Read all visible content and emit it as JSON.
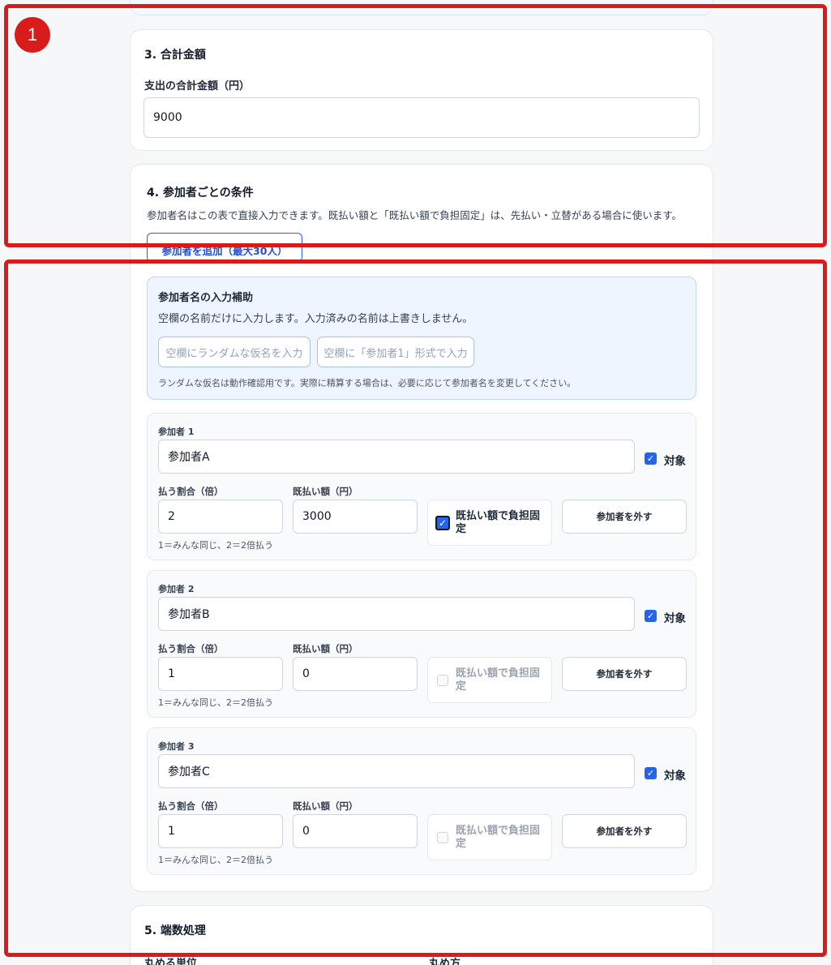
{
  "section3": {
    "title": "3. 合計金額",
    "field_label": "支出の合計金額（円）",
    "value": "9000"
  },
  "section4": {
    "title": "4. 参加者ごとの条件",
    "description": "参加者名はこの表で直接入力できます。既払い額と「既払い額で負担固定」は、先払い・立替がある場合に使います。",
    "add_button": "参加者を追加（最大30人）",
    "helper": {
      "title": "参加者名の入力補助",
      "description": "空欄の名前だけに入力します。入力済みの名前は上書きしません。",
      "random_button": "空欄にランダムな仮名を入力",
      "format_button": "空欄に「参加者1」形式で入力",
      "note": "ランダムな仮名は動作確認用です。実際に精算する場合は、必要に応じて参加者名を変更してください。"
    },
    "participants": [
      {
        "label": "参加者 1",
        "name": "参加者A",
        "target_label": "対象",
        "target_checked": true,
        "ratio_label": "払う割合（倍）",
        "ratio": "2",
        "paid_label": "既払い額（円）",
        "paid": "3000",
        "fixed_label": "既払い額で負担固定",
        "fixed_checked": true,
        "remove_button": "参加者を外す",
        "ratio_hint": "1＝みんな同じ、2＝2倍払う"
      },
      {
        "label": "参加者 2",
        "name": "参加者B",
        "target_label": "対象",
        "target_checked": true,
        "ratio_label": "払う割合（倍）",
        "ratio": "1",
        "paid_label": "既払い額（円）",
        "paid": "0",
        "fixed_label": "既払い額で負担固定",
        "fixed_checked": false,
        "remove_button": "参加者を外す",
        "ratio_hint": "1＝みんな同じ、2＝2倍払う"
      },
      {
        "label": "参加者 3",
        "name": "参加者C",
        "target_label": "対象",
        "target_checked": true,
        "ratio_label": "払う割合（倍）",
        "ratio": "1",
        "paid_label": "既払い額（円）",
        "paid": "0",
        "fixed_label": "既払い額で負担固定",
        "fixed_checked": false,
        "remove_button": "参加者を外す",
        "ratio_hint": "1＝みんな同じ、2＝2倍払う"
      }
    ]
  },
  "section5": {
    "title": "5. 端数処理",
    "unit_label": "丸める単位",
    "method_label": "丸め方"
  },
  "annotation": {
    "badge": "1",
    "color": "#d81b1b"
  },
  "colors": {
    "accent": "#2563eb",
    "helper_bg": "#eef5ff"
  }
}
